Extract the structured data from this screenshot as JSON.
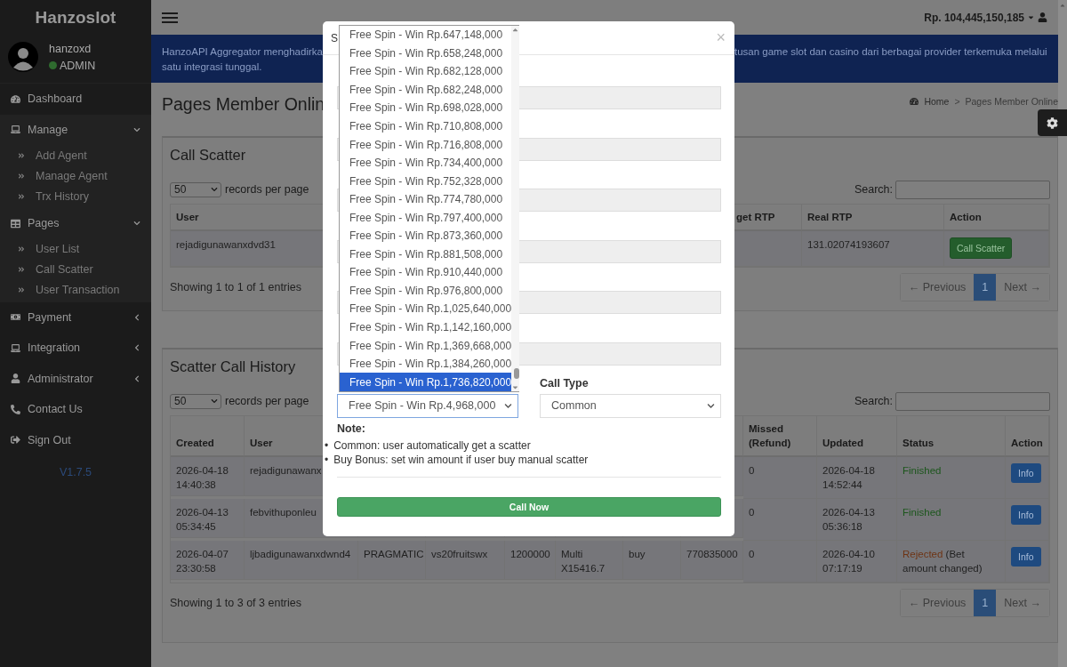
{
  "sidebar": {
    "logo": "Hanzoslot",
    "user": {
      "name": "hanzoxd",
      "role": "ADMIN",
      "online": true
    },
    "menu": [
      {
        "label": "Dashboard",
        "kind": "link"
      },
      {
        "label": "Manage",
        "kind": "group",
        "expanded": true,
        "children": [
          {
            "label": "Add Agent"
          },
          {
            "label": "Manage Agent"
          },
          {
            "label": "Trx History"
          }
        ]
      },
      {
        "label": "Pages",
        "kind": "group",
        "expanded": true,
        "children": [
          {
            "label": "User List"
          },
          {
            "label": "Call Scatter"
          },
          {
            "label": "User Transaction"
          }
        ]
      },
      {
        "label": "Payment",
        "kind": "group",
        "expanded": false
      },
      {
        "label": "Integration",
        "kind": "group",
        "expanded": false
      },
      {
        "label": "Administrator",
        "kind": "group",
        "expanded": false
      },
      {
        "label": "Contact Us",
        "kind": "link"
      },
      {
        "label": "Sign Out",
        "kind": "link"
      }
    ],
    "version": "V1.7.5"
  },
  "topbar": {
    "balance": "Rp. 104,445,150,185"
  },
  "banner": {
    "left_lines": [
      "HanzoAPI Aggregator menghadirka",
      "satu integrasi tunggal."
    ],
    "right_line": "tusan game slot dan casino dari berbagai provider terkemuka melalui"
  },
  "page_title": "Pages Member Onlin",
  "breadcrumb": {
    "home": "Home",
    "separator": ">",
    "current": "Pages Member Online"
  },
  "call_scatter": {
    "title": "Call Scatter",
    "page_size": "50",
    "records_label": "records per page",
    "search_label": "Search:",
    "columns": [
      "User",
      "get RTP",
      "Real RTP",
      "Action"
    ],
    "rows": [
      {
        "user": "rejadigunawanxdvd31",
        "real_rtp": "131.02074193607",
        "action": "Call Scatter"
      }
    ],
    "info": "Showing 1 to 1 of 1 entries",
    "pagination": [
      {
        "label": "← Previous",
        "selected": false
      },
      {
        "label": "1",
        "selected": true
      },
      {
        "label": "Next →",
        "selected": false
      }
    ]
  },
  "history": {
    "title": "Scatter Call History",
    "page_size": "50",
    "records_label": "records per page",
    "search_label": "Search:",
    "columns": [
      "Created",
      "User",
      "Missed (Refund)",
      "Updated",
      "Status",
      "Action"
    ],
    "rows": [
      {
        "cells": [
          "2026-04-18 14:40:38",
          "rejadigunawanx"
        ],
        "missed": "0",
        "updated": "2026-04-18 14:52:44",
        "status": {
          "kind": "finished",
          "label": "Finished"
        },
        "action": "Info"
      },
      {
        "cells": [
          "2026-04-13 05:34:45",
          "febvithuponleu"
        ],
        "missed": "0",
        "updated": "2026-04-13 05:36:18",
        "status": {
          "kind": "finished",
          "label": "Finished"
        },
        "action": "Info"
      },
      {
        "cells": [
          "2026-04-07 23:30:58",
          "ljbadigunawanxdwnd4",
          "PRAGMATIC",
          "vs20fruitswx",
          "1200000",
          "Multi X15416.7",
          "buy",
          "770835000"
        ],
        "missed": "0",
        "updated": "2026-04-10 07:17:19",
        "status": {
          "kind": "rejected",
          "label": "Rejected",
          "note": "(Bet amount changed)"
        },
        "action": "Info"
      }
    ],
    "info": "Showing 1 to 3 of 3 entries",
    "pagination": [
      {
        "label": "← Previous",
        "selected": false
      },
      {
        "label": "1",
        "selected": true
      },
      {
        "label": "Next →",
        "selected": false
      }
    ]
  },
  "modal": {
    "title": "S",
    "close": "×",
    "fields": [
      {
        "disabled": true
      },
      {
        "disabled": true
      },
      {
        "disabled": true
      },
      {
        "disabled": true
      },
      {
        "disabled": true
      },
      {
        "disabled": true
      }
    ],
    "win_select": {
      "value": "Free Spin - Win Rp.4,968,000",
      "options": [
        {
          "label": "Free Spin - Win Rp.647,148,000",
          "selected": false
        },
        {
          "label": "Free Spin - Win Rp.658,248,000",
          "selected": false
        },
        {
          "label": "Free Spin - Win Rp.682,128,000",
          "selected": false
        },
        {
          "label": "Free Spin - Win Rp.682,248,000",
          "selected": false
        },
        {
          "label": "Free Spin - Win Rp.698,028,000",
          "selected": false
        },
        {
          "label": "Free Spin - Win Rp.710,808,000",
          "selected": false
        },
        {
          "label": "Free Spin - Win Rp.716,808,000",
          "selected": false
        },
        {
          "label": "Free Spin - Win Rp.734,400,000",
          "selected": false
        },
        {
          "label": "Free Spin - Win Rp.752,328,000",
          "selected": false
        },
        {
          "label": "Free Spin - Win Rp.774,780,000",
          "selected": false
        },
        {
          "label": "Free Spin - Win Rp.797,400,000",
          "selected": false
        },
        {
          "label": "Free Spin - Win Rp.873,360,000",
          "selected": false
        },
        {
          "label": "Free Spin - Win Rp.881,508,000",
          "selected": false
        },
        {
          "label": "Free Spin - Win Rp.910,440,000",
          "selected": false
        },
        {
          "label": "Free Spin - Win Rp.976,800,000",
          "selected": false
        },
        {
          "label": "Free Spin - Win Rp.1,025,640,000",
          "selected": false
        },
        {
          "label": "Free Spin - Win Rp.1,142,160,000",
          "selected": false
        },
        {
          "label": "Free Spin - Win Rp.1,369,668,000",
          "selected": false
        },
        {
          "label": "Free Spin - Win Rp.1,384,260,000",
          "selected": false
        },
        {
          "label": "Free Spin - Win Rp.1,736,820,000",
          "selected": true
        }
      ]
    },
    "call_type": {
      "label": "Call Type",
      "value": "Common"
    },
    "note_title": "Note:",
    "notes": [
      {
        "bullet": "•",
        "text": "Common: user automatically get a scatter"
      },
      {
        "bullet": "•",
        "text": "Buy Bonus: set win amount if user buy manual scatter"
      }
    ],
    "submit": "Call Now"
  }
}
